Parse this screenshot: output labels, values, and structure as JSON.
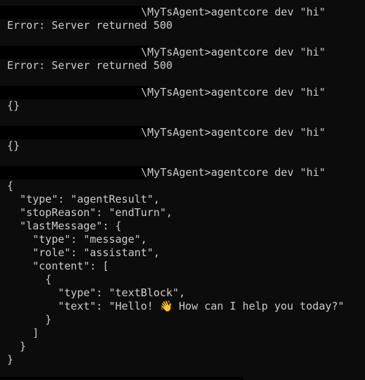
{
  "terminal": {
    "command_prompt": "\\MyTsAgent>agentcore dev \"hi\"",
    "runs": [
      {
        "output": [
          "Error: Server returned 500"
        ]
      },
      {
        "output": [
          "Error: Server returned 500"
        ]
      },
      {
        "output": [
          "{}"
        ]
      },
      {
        "output": [
          "{}"
        ]
      },
      {
        "output": [
          "{",
          "  \"type\": \"agentResult\",",
          "  \"stopReason\": \"endTurn\",",
          "  \"lastMessage\": {",
          "    \"type\": \"message\",",
          "    \"role\": \"assistant\",",
          "    \"content\": [",
          "      {",
          "        \"type\": \"textBlock\",",
          "        \"text_prefix\": \"        \\\"text\\\": \\\"Hello! \",",
          "        \"text_suffix\": \" How can I help you today?\\\"\"",
          "      }",
          "    ]",
          "  }",
          "}"
        ]
      }
    ],
    "final_json": {
      "line_open": "{",
      "type_line": "  \"type\": \"agentResult\",",
      "stop_line": "  \"stopReason\": \"endTurn\",",
      "last_line": "  \"lastMessage\": {",
      "msg_type_line": "    \"type\": \"message\",",
      "role_line": "    \"role\": \"assistant\",",
      "content_line": "    \"content\": [",
      "block_open": "      {",
      "block_type_line": "        \"type\": \"textBlock\",",
      "text_prefix": "        \"text\": \"Hello! ",
      "emoji_icon": "waving-hand-icon",
      "emoji_glyph": "👋",
      "text_suffix": " How can I help you today?\"",
      "block_close": "      }",
      "content_close": "    ]",
      "last_close": "  }",
      "line_close": "}"
    },
    "error_text": "Error: Server returned 500",
    "empty_object": "{}"
  }
}
